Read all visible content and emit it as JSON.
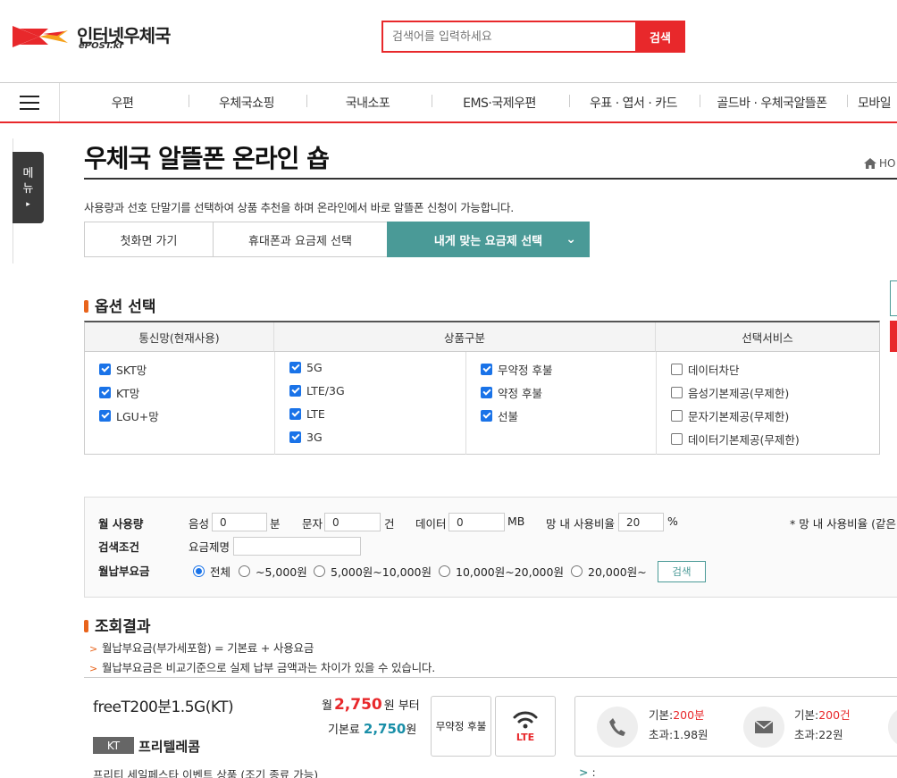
{
  "header": {
    "logo_title": "인터넷우체국",
    "logo_sub": "ePOST.kr",
    "search_placeholder": "검색어를 입력하세요",
    "search_button": "검색"
  },
  "nav": {
    "items": [
      "우편",
      "우체국쇼핑",
      "국내소포",
      "EMS·국제우편",
      "우표 · 엽서 · 카드",
      "골드바 · 우체국알뜰폰",
      "모바일"
    ]
  },
  "side_menu": {
    "label": "메뉴",
    "arrow": "▸"
  },
  "page": {
    "title": "우체국 알뜰폰 온라인 숍",
    "breadcrumb_home": "HO",
    "intro": "사용량과 선호 단말기를 선택하여 상품 추천을 하며 온라인에서 바로 알뜰폰 신청이 가능합니다."
  },
  "tabs": [
    {
      "label": "첫화면 가기",
      "active": false
    },
    {
      "label": "휴대폰과 요금제 선택",
      "active": false
    },
    {
      "label": "내게 맞는 요금제 선택",
      "active": true
    }
  ],
  "tab_chevron": "⌄",
  "options": {
    "heading": "옵션 선택",
    "col_network": "통신망(현재사용)",
    "col_product": "상품구분",
    "col_service": "선택서비스",
    "network": [
      {
        "label": "SKT망",
        "checked": true
      },
      {
        "label": "KT망",
        "checked": true
      },
      {
        "label": "LGU+망",
        "checked": true
      }
    ],
    "product_gen": [
      {
        "label": "5G",
        "checked": true
      },
      {
        "label": "LTE/3G",
        "checked": true
      },
      {
        "label": "LTE",
        "checked": true
      },
      {
        "label": "3G",
        "checked": true
      }
    ],
    "product_contract": [
      {
        "label": "무약정 후불",
        "checked": true
      },
      {
        "label": "약정 후불",
        "checked": true
      },
      {
        "label": "선불",
        "checked": true
      }
    ],
    "services": [
      {
        "label": "데이터차단",
        "checked": false
      },
      {
        "label": "음성기본제공(무제한)",
        "checked": false
      },
      {
        "label": "문자기본제공(무제한)",
        "checked": false
      },
      {
        "label": "데이터기본제공(무제한)",
        "checked": false
      }
    ]
  },
  "conditions": {
    "usage_label": "월 사용량",
    "voice_label": "음성",
    "voice_value": "0",
    "voice_unit": "분",
    "sms_label": "문자",
    "sms_value": "0",
    "sms_unit": "건",
    "data_label": "데이터",
    "data_value": "0",
    "data_unit": "MB",
    "net_ratio_label": "망 내 사용비율",
    "net_ratio_value": "20",
    "net_ratio_unit": "%",
    "net_ratio_note": "* 망 내 사용비율 (같은",
    "search_cond_label": "검색조건",
    "plan_name_label": "요금제명",
    "plan_name_value": "",
    "fee_label": "월납부요금",
    "fee_options": [
      {
        "label": "전체",
        "checked": true
      },
      {
        "label": "~5,000원",
        "checked": false
      },
      {
        "label": "5,000원~10,000원",
        "checked": false
      },
      {
        "label": "10,000원~20,000원",
        "checked": false
      },
      {
        "label": "20,000원~",
        "checked": false
      }
    ],
    "search_button": "검색"
  },
  "results": {
    "heading": "조회결과",
    "notes": [
      "월납부요금(부가세포함) = 기본료 + 사용요금",
      "월납부요금은 비교기준으로 실제 납부 금액과는 차이가 있을 수 있습니다."
    ],
    "plan": {
      "name": "freeT200분1.5G(KT)",
      "carrier": "KT",
      "vendor": "프리텔레콤",
      "price_prefix": "월",
      "price_value": "2,750",
      "price_suffix": "원 부터",
      "base_label": "기본료",
      "base_value": "2,750",
      "base_unit": "원",
      "contract_type": "무약정 후불",
      "network_type": "LTE",
      "voice_base_label": "기본:",
      "voice_base_value": "200분",
      "voice_over": "초과:1.98원",
      "sms_base_label": "기본:",
      "sms_base_value": "200건",
      "sms_over": "초과:22원",
      "event_note": "프리티 세일페스타 이벤트 상품 (조기 종료 가능)",
      "extra": ":"
    }
  },
  "colors": {
    "accent_red": "#e8282b",
    "teal": "#4a9a97",
    "orange": "#e8641c",
    "price_blue": "#1a8fa8"
  },
  "icons": [
    "epost-logo-icon",
    "menu-icon",
    "home-icon",
    "wifi-icon",
    "phone-icon",
    "envelope-icon"
  ]
}
